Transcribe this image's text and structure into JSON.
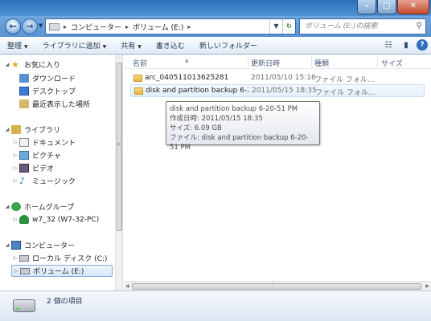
{
  "address": {
    "crumbs": [
      "コンピューター",
      "ボリューム (E:)"
    ],
    "search_placeholder": "ボリューム (E:)の検索"
  },
  "toolbar": {
    "items": [
      "整理",
      "ライブラリに追加",
      "共有",
      "書き込む",
      "新しいフォルダー"
    ]
  },
  "nav": {
    "favorites": "お気に入り",
    "downloads": "ダウンロード",
    "desktop": "デスクトップ",
    "recent": "最近表示した場所",
    "libraries": "ライブラリ",
    "documents": "ドキュメント",
    "pictures": "ピクチャ",
    "videos": "ビデオ",
    "music": "ミュージック",
    "homegroup": "ホームグループ",
    "user": "w7_32 (W7-32-PC)",
    "computer": "コンピューター",
    "local_disk": "ローカル ディスク (C:)",
    "volume": "ボリューム (E:)"
  },
  "columns": {
    "name": "名前",
    "date": "更新日時",
    "type": "種類",
    "size": "サイズ"
  },
  "files": [
    {
      "name": "arc_040511013625281",
      "date": "2011/05/10 15:16",
      "type": "ファイル フォル..."
    },
    {
      "name": "disk and partition backup 6-2...",
      "date": "2011/05/15 18:35",
      "type": "ファイル フォル..."
    }
  ],
  "tooltip": {
    "line1": "disk and partition backup 6-20-51 PM",
    "line2": "作成日時: 2011/05/15 18:35",
    "line3": "サイズ: 6.09 GB",
    "line4": "ファイル: disk and partition backup 6-20-51 PM"
  },
  "status": {
    "item_count": "2 個の項目"
  }
}
